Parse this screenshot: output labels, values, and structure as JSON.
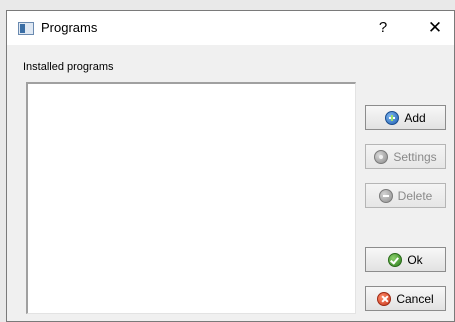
{
  "window": {
    "title": "Programs",
    "help_glyph": "?",
    "close_glyph": "✕"
  },
  "programs": {
    "label": "Installed programs",
    "items": []
  },
  "buttons": {
    "add": {
      "label": "Add",
      "icon": "add-icon",
      "enabled": true
    },
    "settings": {
      "label": "Settings",
      "icon": "settings-icon",
      "enabled": false
    },
    "delete": {
      "label": "Delete",
      "icon": "delete-icon",
      "enabled": false
    },
    "ok": {
      "label": "Ok",
      "icon": "ok-icon",
      "enabled": true
    },
    "cancel": {
      "label": "Cancel",
      "icon": "cancel-icon",
      "enabled": true
    }
  }
}
